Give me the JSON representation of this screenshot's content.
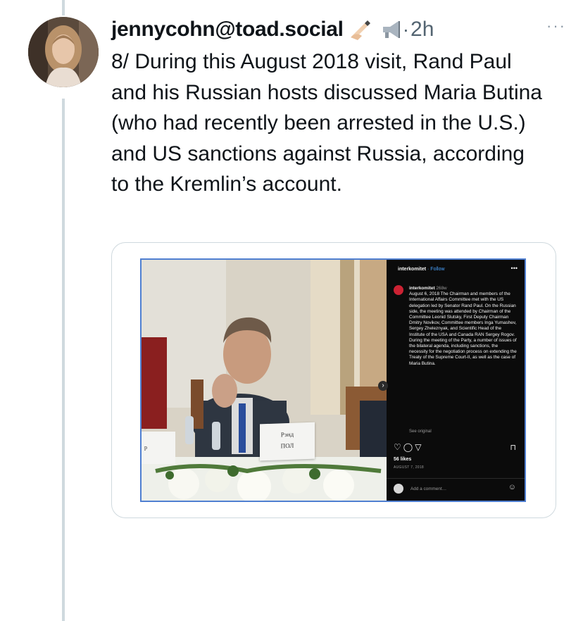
{
  "post": {
    "author": "jennycohn@toad.social",
    "badge_emojis": [
      "writing-hand",
      "megaphone"
    ],
    "separator": "·",
    "time": "2h",
    "more_label": "···",
    "text": "8/ During this August 2018 visit, Rand Paul and his Russian hosts discussed Maria Butina (who had recently been arrested in the U.S.) and US sanctions against Russia, according to the Kremlin’s account."
  },
  "embedded_image": {
    "placard_text": "Рэнд\nПОЛ",
    "placard_left_text": "р",
    "instagram": {
      "account": "interkomitet",
      "follow_label": "· Follow",
      "menu_label": "•••",
      "caption_user": "interkomitet",
      "caption_age": "268w",
      "caption": "August 6, 2018 The Chairman and members of the International Affairs Committee met with the US delegation led by Senator Rand Paul. On the Russian side, the meeting was attended by Chairman of the Committee Leonid Slutsky, First Deputy Chairman Dmitry Novikov, Committee members Inga Yumashev, Sergey Zheleznyak, and Scientific Head of the Institute of the USA and Canada RAN Sergey Rogov. During the meeting of the Party, a number of issues of the bilateral agenda, including sanctions, the necessity for the negotiation process on extending the Treaty of the Supreme Court-II, as well as the case of Maria Butina.",
      "see_original": "See original",
      "likes": "56 likes",
      "date": "AUGUST 7, 2018",
      "add_comment": "Add a comment…",
      "action_icons": [
        "heart-icon",
        "comment-icon",
        "share-icon"
      ],
      "bookmark_icon": "bookmark-icon"
    }
  },
  "colors": {
    "text": "#0f1419",
    "muted": "#536471",
    "thread_line": "#cfd9de",
    "card_border": "#cfd9de",
    "image_border": "#4f7fd1",
    "follow_link": "#4aa3ff"
  }
}
